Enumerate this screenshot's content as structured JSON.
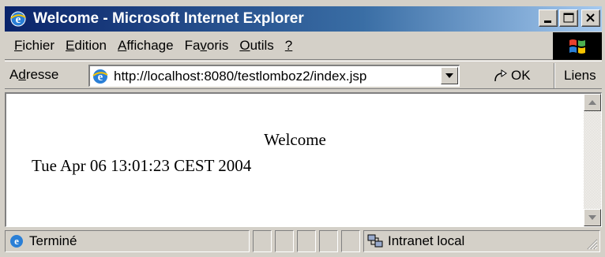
{
  "window": {
    "title": "Welcome - Microsoft Internet Explorer",
    "icon": "ie-logo-icon"
  },
  "menu": {
    "items": [
      {
        "u": "F",
        "rest": "ichier"
      },
      {
        "u": "E",
        "rest": "dition"
      },
      {
        "u": "A",
        "rest": "ffichage"
      },
      {
        "pre": "Fa",
        "u": "v",
        "rest": "oris"
      },
      {
        "u": "O",
        "rest": "utils"
      },
      {
        "u": "?",
        "rest": ""
      }
    ]
  },
  "address": {
    "label_pre": "A",
    "label_u": "d",
    "label_rest": "resse",
    "url": "http://localhost:8080/testlomboz2/index.jsp",
    "go_label": "OK",
    "links_label": "Liens"
  },
  "page": {
    "heading": "Welcome",
    "datetime": "Tue Apr 06 13:01:23 CEST 2004"
  },
  "status": {
    "text": "Terminé",
    "zone": "Intranet local"
  },
  "colors": {
    "titlebar_start": "#0a246a",
    "titlebar_end": "#a6caf0",
    "chrome": "#d4d0c8"
  }
}
